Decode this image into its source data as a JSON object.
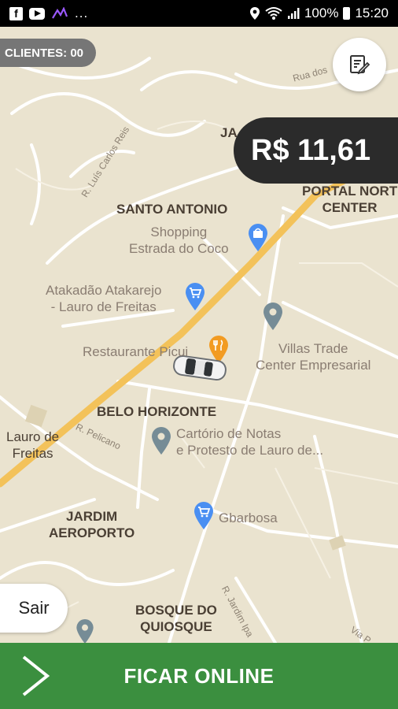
{
  "status_bar": {
    "left_icons": [
      "facebook-icon",
      "youtube-icon",
      "app-icon",
      "more-dots"
    ],
    "more": "...",
    "battery": "100%",
    "time": "15:20"
  },
  "clients_badge": "CLIENTES: 00",
  "fare": "R$ 11,61",
  "map": {
    "neighborhoods": [
      "SANTO ANTONIO",
      "BELO HORIZONTE",
      "JARDIM\nAEROPORTO",
      "BOSQUE DO\nQUIOSQUE",
      "PORTAL NORT\nCENTER",
      "JA"
    ],
    "pois": [
      "Shopping\nEstrada do Coco",
      "Atakadão Atakarejo\n- Lauro de Freitas",
      "Restaurante Picui",
      "Villas Trade\nCenter Empresarial",
      "Cartório de Notas\ne Protesto de Lauro de...",
      "Gbarbosa",
      "Lauro de\nFreitas"
    ],
    "streets": [
      "R. Luís Carlos Reis",
      "Rua dos",
      "R. Pelicano",
      "R. Jardim Ipa",
      "Via P"
    ]
  },
  "sair_label": "Sair",
  "online_label": "FICAR ONLINE",
  "colors": {
    "map_bg": "#eae3cf",
    "road": "#ffffff",
    "highway": "#f3c25a",
    "fare_bg": "#2b2b2b",
    "online_bg": "#3b8f3f",
    "poi_blue": "#4a8ff2",
    "poi_orange": "#f29b22",
    "poi_gray": "#768c96"
  }
}
